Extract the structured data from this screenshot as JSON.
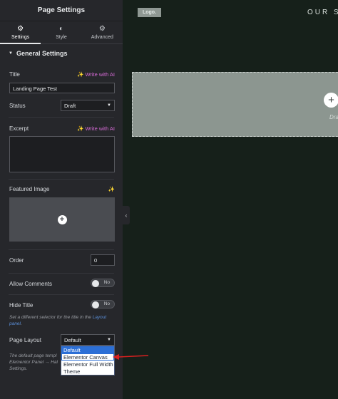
{
  "panel": {
    "title": "Page Settings",
    "tabs": [
      {
        "label": "Settings",
        "icon": "gear-icon",
        "active": true
      },
      {
        "label": "Style",
        "icon": "half-circle-icon",
        "active": false
      },
      {
        "label": "Advanced",
        "icon": "gear-icon",
        "active": false
      }
    ],
    "section_title": "General Settings",
    "title_field": {
      "label": "Title",
      "value": "Landing Page Test",
      "ai_label": "Write with AI"
    },
    "status_field": {
      "label": "Status",
      "value": "Draft"
    },
    "excerpt_field": {
      "label": "Excerpt",
      "value": "",
      "ai_label": "Write with AI"
    },
    "featured_image": {
      "label": "Featured Image"
    },
    "order_field": {
      "label": "Order",
      "value": "0"
    },
    "allow_comments": {
      "label": "Allow Comments",
      "state": "No"
    },
    "hide_title": {
      "label": "Hide Title",
      "state": "No"
    },
    "hide_title_help": {
      "prefix": "Set a different selector for the title in the ",
      "link": "Layout panel",
      "suffix": "."
    },
    "page_layout": {
      "label": "Page Layout",
      "value": "Default",
      "options": [
        "Default",
        "Elementor Canvas",
        "Elementor Full Width",
        "Theme"
      ],
      "selected_index": 0,
      "highlighted_index": 1
    },
    "page_layout_help": [
      "The default page templ",
      "Elementor Panel → Hal",
      "Settings."
    ]
  },
  "preview": {
    "logo": "Logo.",
    "nav": "OUR ST",
    "drop_text": "Drag"
  },
  "colors": {
    "panel_bg": "#26272b",
    "preview_bg": "#16201a",
    "ai_accent": "#d66bd6",
    "selection_blue": "#2c6fd6",
    "annotation_red": "#d92020"
  }
}
